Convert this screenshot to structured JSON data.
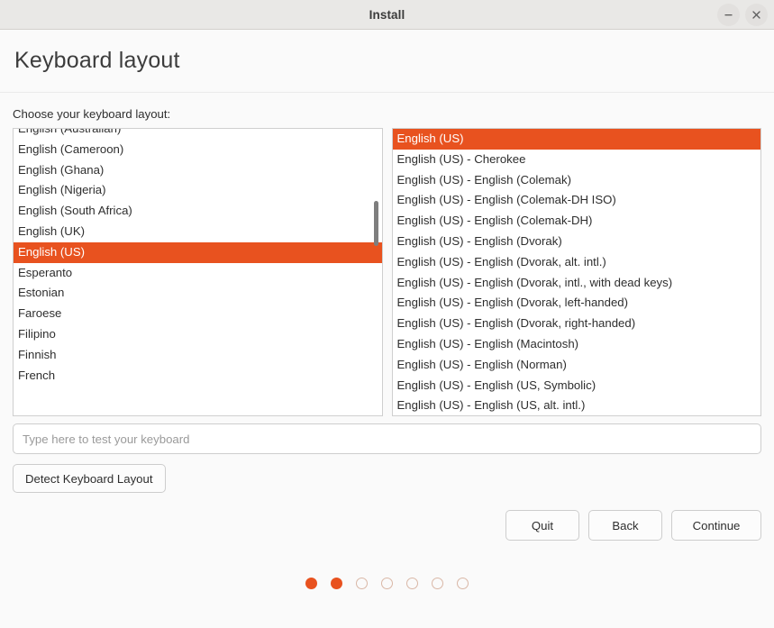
{
  "window": {
    "title": "Install",
    "minimize_icon": "minimize-icon",
    "close_icon": "close-icon"
  },
  "header": {
    "title": "Keyboard layout"
  },
  "content": {
    "choose_label": "Choose your keyboard layout:"
  },
  "layout_list": {
    "partial_top_item": "English (Australian)",
    "selected": "English (US)",
    "items": [
      "English (Australian)",
      "English (Cameroon)",
      "English (Ghana)",
      "English (Nigeria)",
      "English (South Africa)",
      "English (UK)",
      "English (US)",
      "Esperanto",
      "Estonian",
      "Faroese",
      "Filipino",
      "Finnish",
      "French"
    ]
  },
  "variant_list": {
    "selected": "English (US)",
    "items": [
      "English (US)",
      "English (US) - Cherokee",
      "English (US) - English (Colemak)",
      "English (US) - English (Colemak-DH ISO)",
      "English (US) - English (Colemak-DH)",
      "English (US) - English (Dvorak)",
      "English (US) - English (Dvorak, alt. intl.)",
      "English (US) - English (Dvorak, intl., with dead keys)",
      "English (US) - English (Dvorak, left-handed)",
      "English (US) - English (Dvorak, right-handed)",
      "English (US) - English (Macintosh)",
      "English (US) - English (Norman)",
      "English (US) - English (US, Symbolic)",
      "English (US) - English (US, alt. intl.)"
    ]
  },
  "test_input": {
    "placeholder": "Type here to test your keyboard",
    "value": ""
  },
  "detect_button": {
    "label": "Detect Keyboard Layout"
  },
  "nav": {
    "quit": "Quit",
    "back": "Back",
    "continue": "Continue"
  },
  "progress": {
    "total": 7,
    "completed": 2
  },
  "colors": {
    "accent": "#e8521f",
    "titlebar": "#e9e8e6",
    "body": "#fafafa",
    "dot_empty_border": "#d9b7a6"
  }
}
